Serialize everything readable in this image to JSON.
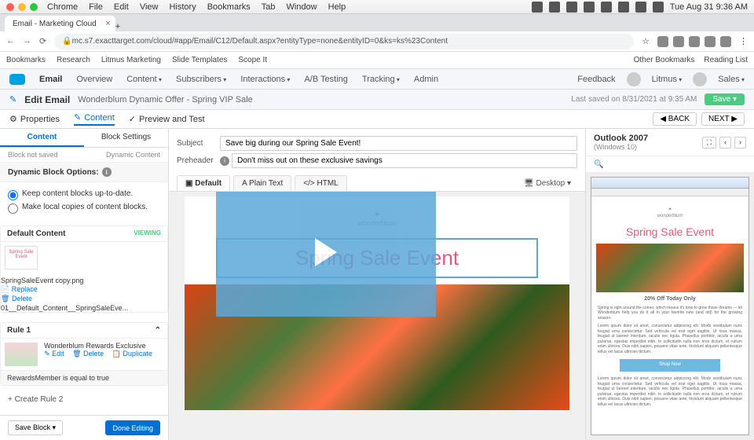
{
  "mac": {
    "menus": [
      "Chrome",
      "File",
      "Edit",
      "View",
      "History",
      "Bookmarks",
      "Tab",
      "Window",
      "Help"
    ],
    "clock": "Tue Aug 31  9:36 AM"
  },
  "browser": {
    "tab": "Email - Marketing Cloud",
    "url": "mc.s7.exacttarget.com/cloud/#app/Email/C12/Default.aspx?entityType=none&entityID=0&ks=ks%23Content"
  },
  "bookmarks": {
    "items": [
      "Bookmarks",
      "Research",
      "Litmus Marketing",
      "Slide Templates",
      "Scope It"
    ],
    "right": [
      "Other Bookmarks",
      "Reading List"
    ]
  },
  "app": {
    "brand": "Email",
    "nav": [
      "Overview",
      "Content",
      "Subscribers",
      "Interactions",
      "A/B Testing",
      "Tracking",
      "Admin"
    ],
    "feedback": "Feedback",
    "litmus": "Litmus",
    "sales": "Sales"
  },
  "edit": {
    "title": "Edit Email",
    "name": "Wonderblum Dynamic Offer - Spring VIP Sale",
    "saved": "Last saved on 8/31/2021 at 9:35 AM",
    "save": "Save"
  },
  "toolbar": {
    "props": "Properties",
    "content": "Content",
    "preview": "Preview and Test",
    "back": "◀ BACK",
    "next": "NEXT ▶"
  },
  "left": {
    "tabs": [
      "Content",
      "Block Settings"
    ],
    "status": "Block not saved",
    "dyn": "Dynamic Content",
    "sec1": "Dynamic Block Options:",
    "opt1": "Keep content blocks up-to-date.",
    "opt2": "Make local copies of content blocks.",
    "defhd": "Default Content",
    "viewing": "VIEWING",
    "thumbtxt": "Spring Sale Event",
    "file": "SpringSaleEvent copy.png",
    "replace": "Replace",
    "delete": "Delete",
    "long": "01__Default_Content__SpringSaleEve...",
    "rule1": "Rule 1",
    "r1name": "Wonderblum Rewards Exclusive",
    "edit": "Edit",
    "del": "Delete",
    "dup": "Duplicate",
    "cond": "RewardsMember   is equal to   true",
    "addrule": "+  Create Rule 2",
    "saveblk": "Save Block  ▾",
    "done": "Done Editing"
  },
  "center": {
    "subject_lbl": "Subject",
    "subject": "Save big during our Spring Sale Event!",
    "pre_lbl": "Preheader",
    "pre": "Don't miss out on these exclusive savings",
    "tabs": {
      "def": "Default",
      "plain": "Plain Text",
      "html": "HTML"
    },
    "desktop": "Desktop",
    "logo": "wonderblum",
    "title": "Spring Sale Event"
  },
  "right": {
    "title": "Outlook 2007",
    "sub": "(Windows 10)",
    "logo": "wonderblum",
    "hd": "Spring Sale Event",
    "offer": "20% Off Today Only",
    "p1": "Spring is right around the corner, which means it's time to grow those dreams — let Wonderblum help you do it all in your favorite new (and old) for the growing season.",
    "p2": "Lorem ipsum dolor sit amet, consectetur adipiscing elit. Morbi vestibulum nunc feugiat urna consectetur. Sed vehicula vel erat eget sagittis. Ut risus massa, feugiat ut laoreet interdum, iaculis nec ligula. Phasellus porttitor, iaculis a urna pulvinar, egestas imperdiet nibh. In sollicitudin nulla non eros dictum, et rutrum enim ultrices. Duis nibh sapien, posuere vitae ante, tincidunt aliquam pellentesque tellus vel lacus ultricies dictum."
  }
}
